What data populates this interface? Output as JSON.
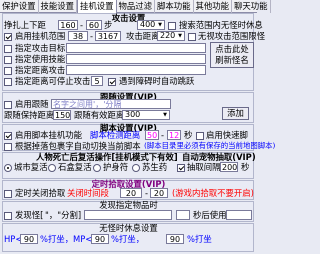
{
  "tabs": [
    "保护设置",
    "技能设置",
    "挂机设置",
    "物品过滤",
    "脚本功能",
    "其他功能",
    "聊天功能"
  ],
  "attack": {
    "title": "攻击设置",
    "random_label": "挣扎上下距",
    "random_min": "160",
    "random_sep": "-",
    "random_max": "60",
    "random_unit": "步",
    "monster_range_value": "400",
    "monster_range_label": "搜索范围内无怪时休息",
    "zone_label": "启用挂机范围",
    "zone_x": "38",
    "zone_sep": "-",
    "zone_y": "3167",
    "attack_dist_label": "攻击距离",
    "attack_dist_value": "220",
    "no_attack_label": "无视攻击范围限怪",
    "specify_monster_label": "指定攻击目标",
    "specify_skill_label": "指定使用技能",
    "specify_direction_label": "指定距离攻击",
    "specify_direction_unit": "格",
    "specify_target_label": "指定攻击目标",
    "stop_label": "指定距离可停止攻击",
    "stop_value": "5",
    "stop_suffix": "遇到障碍时自动跳跃",
    "rename_button": "点击此处\n刷新怪名"
  },
  "follow": {
    "title": "跟随设置(VIP)",
    "enable_label": "启用跟随",
    "name_placeholder": "名字之间用'，'分隔",
    "dist_label": "跟随保持距离",
    "dist_value": "150",
    "attack_label": "跟随有效距离",
    "attack_value": "300",
    "add_button": "添加"
  },
  "script": {
    "title": "脚本设置(VIP)",
    "enable_label": "启用脚本挂机功能",
    "hint": "脚本检测距离",
    "range_a": "50",
    "sep": "-",
    "range_b": "12",
    "unit": "秒",
    "fast_label": "启用快速脚",
    "load_label": "根据掉落包裹字自动切换当前脚本",
    "load_hint": "(脚本目录里必须有保存的当前地图脚本)"
  },
  "state": {
    "left_title": "人物死亡后复活操作[挂机模式下有效]",
    "right_title": "自动宠物抽取(VIP)",
    "opt1": "城市复活",
    "opt2": "石盒复活",
    "opt3": "护身符",
    "opt4": "苏生药",
    "opt5": "抽取间隔",
    "opt5_value": "200",
    "opt5_unit": "秒"
  },
  "timer": {
    "title": "定时拾取设置(VIP)",
    "enable_label": "定时关闭拾取",
    "unit_label": "关闭时间段",
    "value": "20",
    "sep": "-",
    "max": "20",
    "hint": "(游戏内拾取不要开启)"
  },
  "pickup": {
    "title": "发现指定物品时",
    "enable_label": "发现怪[",
    "hint": "\"，\"分割]",
    "suffix": "秒后使用"
  },
  "rest": {
    "title": "无怪时休息设置",
    "hp_label": "HP<",
    "hp_value": "90",
    "hp_unit": "%打坐，",
    "hp_unit2": "%打坐",
    "mp_label": "MP<",
    "mp_value": "90",
    "mp_unit": "%打坐，",
    "hp2_value": "90"
  }
}
